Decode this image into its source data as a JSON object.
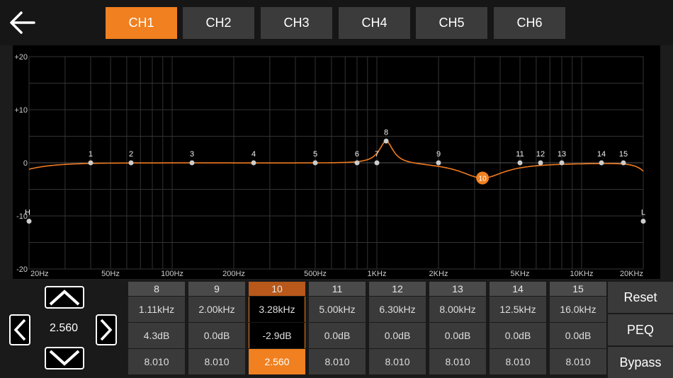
{
  "channels": [
    "CH1",
    "CH2",
    "CH3",
    "CH4",
    "CH5",
    "CH6"
  ],
  "active_channel": "CH1",
  "colors": {
    "accent": "#f08020",
    "curve": "#f07a20",
    "grid": "#3a3a3a",
    "point": "#cccccc"
  },
  "graph": {
    "y_labels": [
      "+20",
      "+10",
      "0",
      "-10",
      "-20"
    ],
    "x_labels": [
      "20Hz",
      "50Hz",
      "100Hz",
      "200Hz",
      "500Hz",
      "1KHz",
      "2KHz",
      "5KHz",
      "10KHz",
      "20KHz"
    ],
    "points": [
      {
        "label": "H",
        "freq": 20,
        "gain": -11
      },
      {
        "label": "1",
        "freq": 40,
        "gain": 0
      },
      {
        "label": "2",
        "freq": 63,
        "gain": 0
      },
      {
        "label": "3",
        "freq": 125,
        "gain": 0
      },
      {
        "label": "4",
        "freq": 250,
        "gain": 0
      },
      {
        "label": "5",
        "freq": 500,
        "gain": 0
      },
      {
        "label": "6",
        "freq": 800,
        "gain": 0
      },
      {
        "label": "7",
        "freq": 1000,
        "gain": 0
      },
      {
        "label": "8",
        "freq": 1110,
        "gain": 4.3
      },
      {
        "label": "9",
        "freq": 2000,
        "gain": 0
      },
      {
        "label": "10",
        "freq": 3280,
        "gain": -2.9,
        "selected": true
      },
      {
        "label": "11",
        "freq": 5000,
        "gain": 0
      },
      {
        "label": "12",
        "freq": 6300,
        "gain": 0
      },
      {
        "label": "13",
        "freq": 8000,
        "gain": 0
      },
      {
        "label": "14",
        "freq": 12500,
        "gain": 0
      },
      {
        "label": "15",
        "freq": 16000,
        "gain": 0
      },
      {
        "label": "L",
        "freq": 20000,
        "gain": -11
      }
    ]
  },
  "q_value": "2.560",
  "bands": [
    {
      "num": "8",
      "freq": "1.11kHz",
      "gain": "4.3dB",
      "q": "8.010"
    },
    {
      "num": "9",
      "freq": "2.00kHz",
      "gain": "0.0dB",
      "q": "8.010"
    },
    {
      "num": "10",
      "freq": "3.28kHz",
      "gain": "-2.9dB",
      "q": "2.560"
    },
    {
      "num": "11",
      "freq": "5.00kHz",
      "gain": "0.0dB",
      "q": "8.010"
    },
    {
      "num": "12",
      "freq": "6.30kHz",
      "gain": "0.0dB",
      "q": "8.010"
    },
    {
      "num": "13",
      "freq": "8.00kHz",
      "gain": "0.0dB",
      "q": "8.010"
    },
    {
      "num": "14",
      "freq": "12.5kHz",
      "gain": "0.0dB",
      "q": "8.010"
    },
    {
      "num": "15",
      "freq": "16.0kHz",
      "gain": "0.0dB",
      "q": "8.010"
    }
  ],
  "selected_band": "10",
  "buttons": {
    "reset": "Reset",
    "peq": "PEQ",
    "bypass": "Bypass"
  }
}
